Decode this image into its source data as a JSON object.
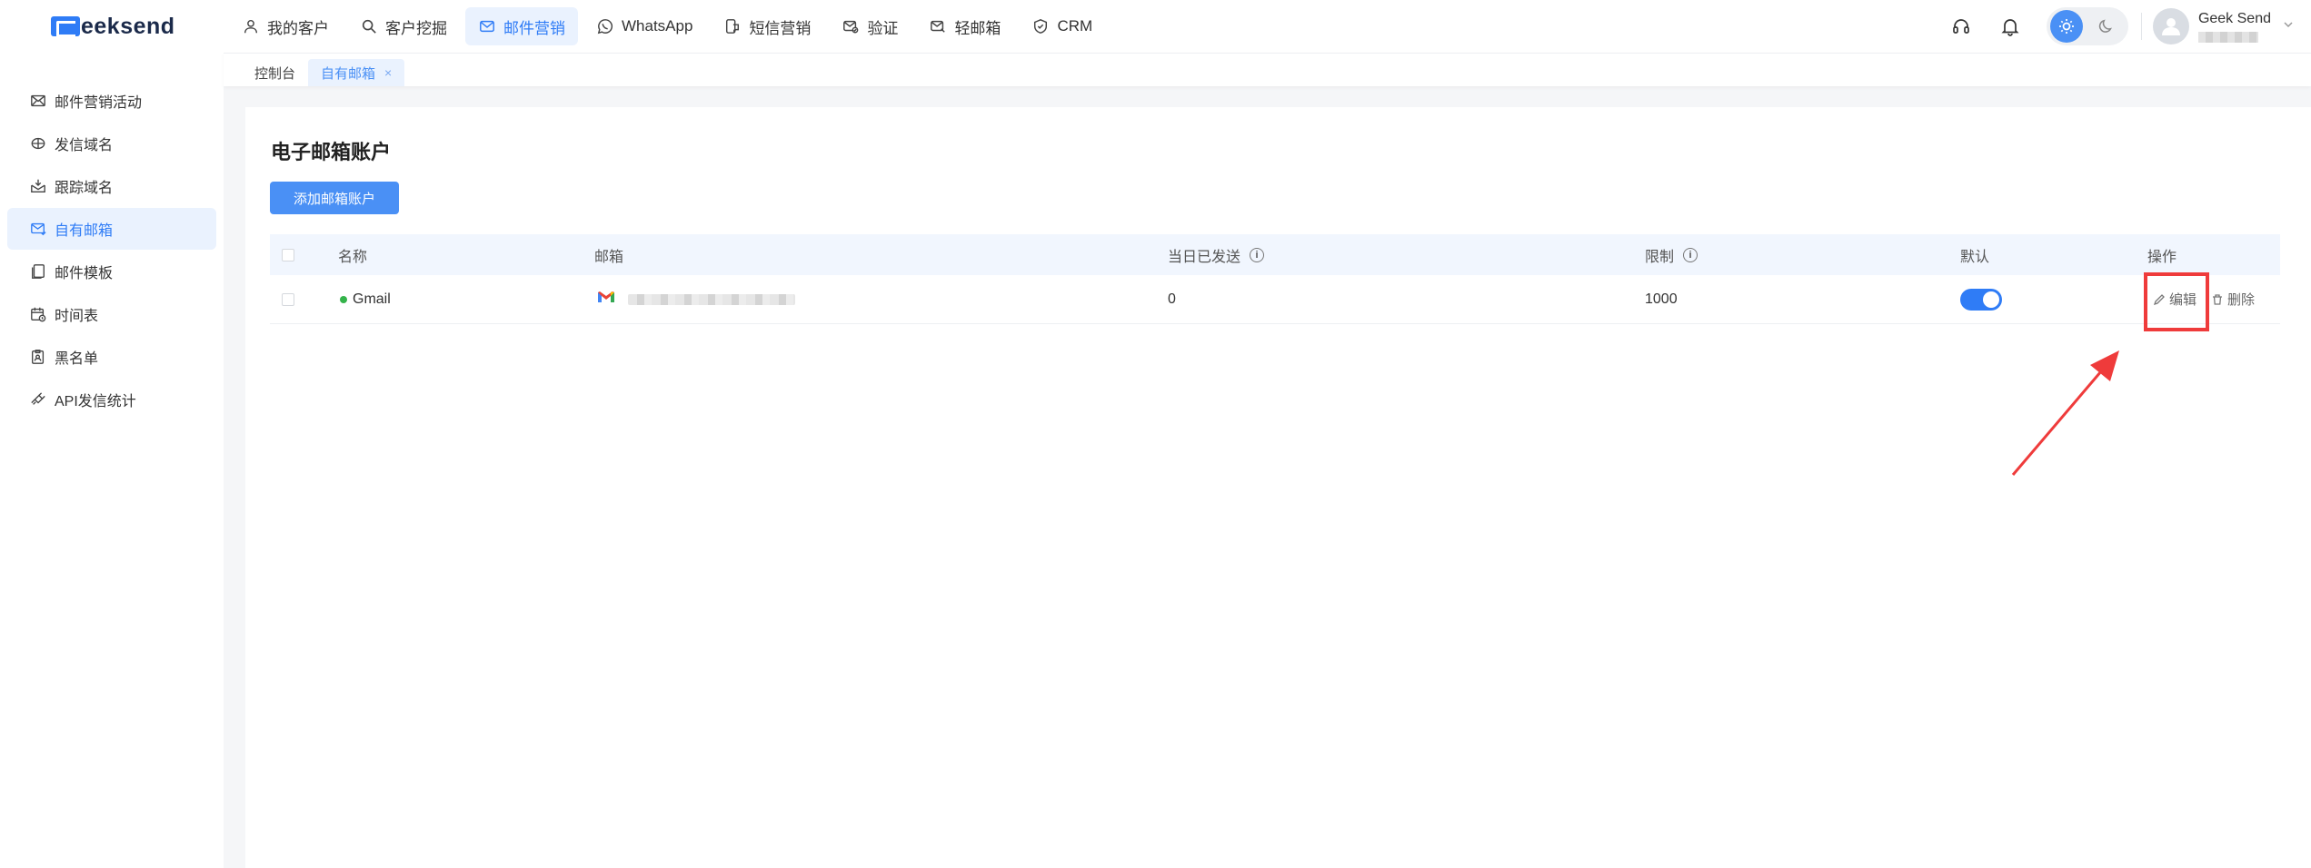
{
  "brand": {
    "logo_text": "eeksend",
    "accent": "#2f7cf6"
  },
  "nav": {
    "items": [
      {
        "label": "我的客户",
        "icon": "user-icon"
      },
      {
        "label": "客户挖掘",
        "icon": "search-icon"
      },
      {
        "label": "邮件营销",
        "icon": "mail-icon",
        "active": true
      },
      {
        "label": "WhatsApp",
        "icon": "whatsapp-icon"
      },
      {
        "label": "短信营销",
        "icon": "sms-icon"
      },
      {
        "label": "验证",
        "icon": "verify-icon"
      },
      {
        "label": "轻邮箱",
        "icon": "light-mail-icon"
      },
      {
        "label": "CRM",
        "icon": "crm-icon"
      }
    ]
  },
  "user": {
    "name": "Geek Send"
  },
  "sidebar": {
    "items": [
      {
        "label": "邮件营销活动",
        "icon": "campaign-icon"
      },
      {
        "label": "发信域名",
        "icon": "domain-icon"
      },
      {
        "label": "跟踪域名",
        "icon": "tracking-icon"
      },
      {
        "label": "自有邮箱",
        "icon": "mailbox-icon",
        "active": true
      },
      {
        "label": "邮件模板",
        "icon": "template-icon"
      },
      {
        "label": "时间表",
        "icon": "schedule-icon"
      },
      {
        "label": "黑名单",
        "icon": "blacklist-icon"
      },
      {
        "label": "API发信统计",
        "icon": "api-icon"
      }
    ]
  },
  "tabs": [
    {
      "label": "控制台"
    },
    {
      "label": "自有邮箱",
      "active": true,
      "close": "×"
    }
  ],
  "main": {
    "title": "电子邮箱账户",
    "add_button": "添加邮箱账户",
    "columns": {
      "name": "名称",
      "email": "邮箱",
      "sent_today": "当日已发送",
      "limit": "限制",
      "default": "默认",
      "actions": "操作"
    },
    "info_glyph": "i",
    "rows": [
      {
        "name": "Gmail",
        "status_color": "#34b34a",
        "sent_today": "0",
        "limit": "1000",
        "default": true,
        "edit": "编辑",
        "delete": "删除"
      }
    ]
  }
}
